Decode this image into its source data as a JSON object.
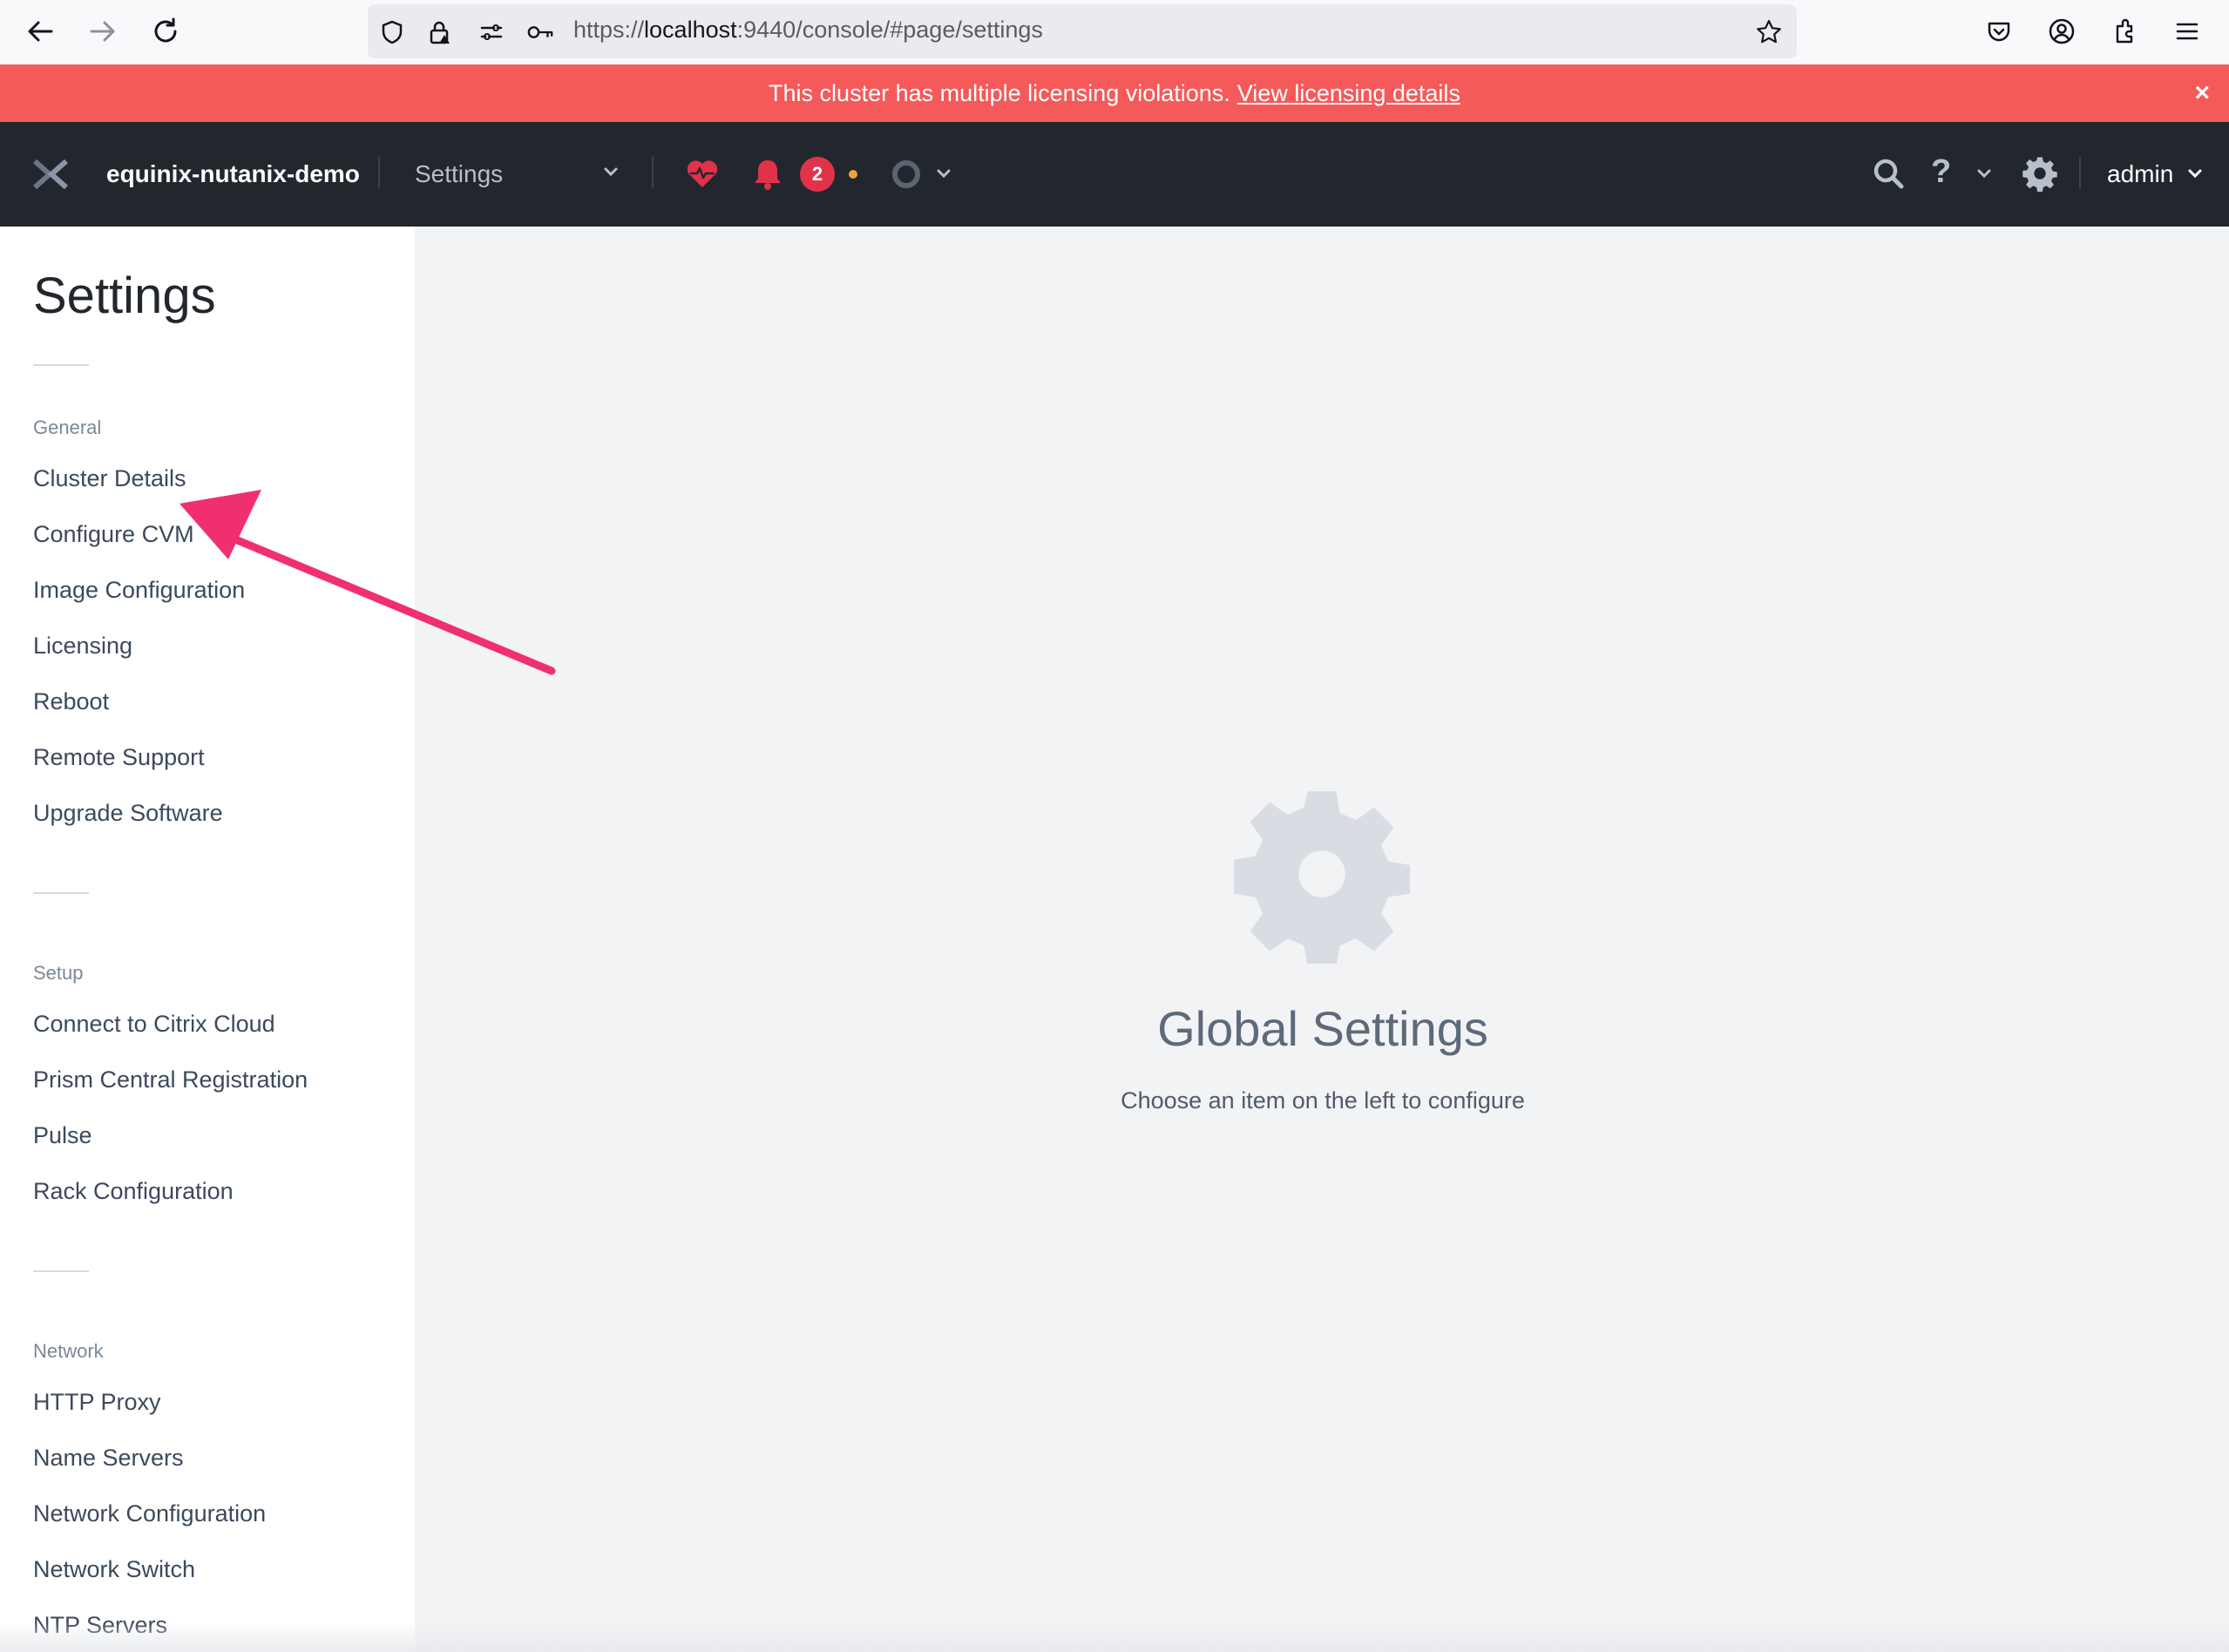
{
  "browser": {
    "url_prefix": "https://",
    "url_host": "localhost",
    "url_rest": ":9440/console/#page/settings"
  },
  "banner": {
    "message": "This cluster has multiple licensing violations.",
    "link": "View licensing details",
    "close": "×"
  },
  "header": {
    "cluster_name": "equinix-nutanix-demo",
    "page_select": "Settings",
    "alert_count": "2",
    "help_label": "?",
    "user": "admin"
  },
  "sidebar": {
    "title": "Settings",
    "sections": [
      {
        "label": "General",
        "items": [
          "Cluster Details",
          "Configure CVM",
          "Image Configuration",
          "Licensing",
          "Reboot",
          "Remote Support",
          "Upgrade Software"
        ]
      },
      {
        "label": "Setup",
        "items": [
          "Connect to Citrix Cloud",
          "Prism Central Registration",
          "Pulse",
          "Rack Configuration"
        ]
      },
      {
        "label": "Network",
        "items": [
          "HTTP Proxy",
          "Name Servers",
          "Network Configuration",
          "Network Switch",
          "NTP Servers"
        ]
      }
    ]
  },
  "main": {
    "title": "Global Settings",
    "subtitle": "Choose an item on the left to configure"
  },
  "colors": {
    "banner": "#f45a5a",
    "header": "#22272e",
    "annotation_arrow": "#f0306e"
  }
}
